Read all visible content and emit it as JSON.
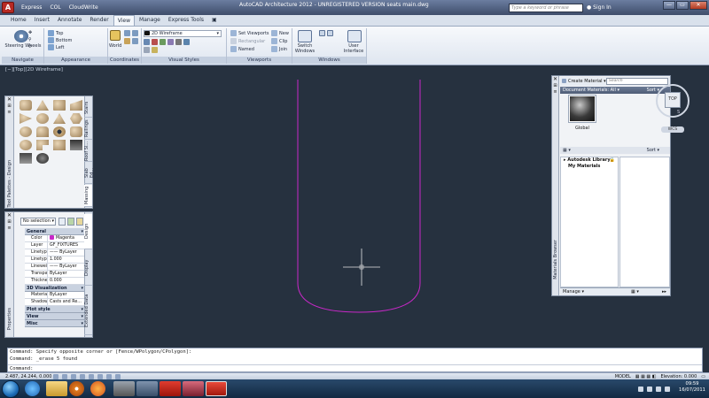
{
  "titlebar": {
    "menus": [
      "Express",
      "COL",
      "CloudWrite"
    ],
    "title": "AutoCAD Architecture 2012 - UNREGISTERED VERSION    seats main.dwg",
    "search_placeholder": "Type a keyword or phrase",
    "signin": "Sign In",
    "window_buttons": [
      "—",
      "▭",
      "✕"
    ]
  },
  "ribbon_tabs": [
    "Home",
    "Insert",
    "Annotate",
    "Render",
    "View",
    "Manage",
    "Express Tools"
  ],
  "active_tab": "View",
  "ribbon": {
    "navigate": {
      "title": "Navigate",
      "steering": "Steering Wheels",
      "views": [
        "Top",
        "Bottom",
        "Left"
      ]
    },
    "appearance": {
      "title": "Appearance"
    },
    "coordinates": {
      "title": "Coordinates",
      "world": "World"
    },
    "visual_styles": {
      "title": "Visual Styles",
      "current": "2D Wireframe"
    },
    "viewports": {
      "title": "Viewports",
      "set": "Set Viewports",
      "rect": "Rectangular",
      "named": "Named",
      "new": "New",
      "clip": "Clip",
      "join": "Join"
    },
    "windows": {
      "title": "Windows",
      "switch": "Switch Windows",
      "ui": "User Interface"
    }
  },
  "viewport_label": "[−][Top][2D Wireframe]",
  "tool_palette": {
    "side_label": "Tool Palettes - Design",
    "tabs": [
      "Stairs",
      "Railings",
      "Roof Sl...",
      "Slab Ed...",
      "Massing"
    ]
  },
  "properties": {
    "side_label": "Properties",
    "selection": "No selection",
    "tabs": [
      "Design",
      "Display",
      "Extended Data"
    ],
    "sections": [
      {
        "name": "General",
        "rows": [
          {
            "k": "Color",
            "v": "Magenta"
          },
          {
            "k": "Layer",
            "v": "GF_FIXTURES"
          },
          {
            "k": "Linetype",
            "v": "—— ByLayer"
          },
          {
            "k": "Linetype ...",
            "v": "1.000"
          },
          {
            "k": "Lineweight",
            "v": "—— ByLayer"
          },
          {
            "k": "Transpar...",
            "v": "ByLayer"
          },
          {
            "k": "Thickness",
            "v": "0.000"
          }
        ]
      },
      {
        "name": "3D Visualization",
        "rows": [
          {
            "k": "Material",
            "v": "ByLayer"
          },
          {
            "k": "Shadow ...",
            "v": "Casts and Re..."
          }
        ]
      },
      {
        "name": "Plot style",
        "rows": []
      },
      {
        "name": "View",
        "rows": []
      },
      {
        "name": "Misc",
        "rows": []
      }
    ]
  },
  "materials": {
    "side_label": "Materials Browser",
    "create": "Create Material",
    "search": "Search",
    "doc_header": "Document Materials: All",
    "sort": "Sort",
    "material_name": "Global",
    "library_sort": "Sort",
    "libraries": [
      "Autodesk Library",
      "My Materials"
    ],
    "manage": "Manage"
  },
  "viewcube": {
    "face": "TOP",
    "south": "S",
    "wcs": "WCS"
  },
  "command": {
    "lines": [
      "Command: Specify opposite corner or [Fence/WPolygon/CPolygon]:",
      "Command: _erase 5 found"
    ],
    "prompt": "Command:"
  },
  "status": {
    "coords": "2.487, 24.244, 0.000",
    "model": "MODEL",
    "elevation": "Elevation: 0.000"
  },
  "clock": {
    "time": "09:59",
    "date": "16/07/2011"
  },
  "colors": {
    "magenta": "#c828c8",
    "cursor": "#e6e6e6"
  }
}
